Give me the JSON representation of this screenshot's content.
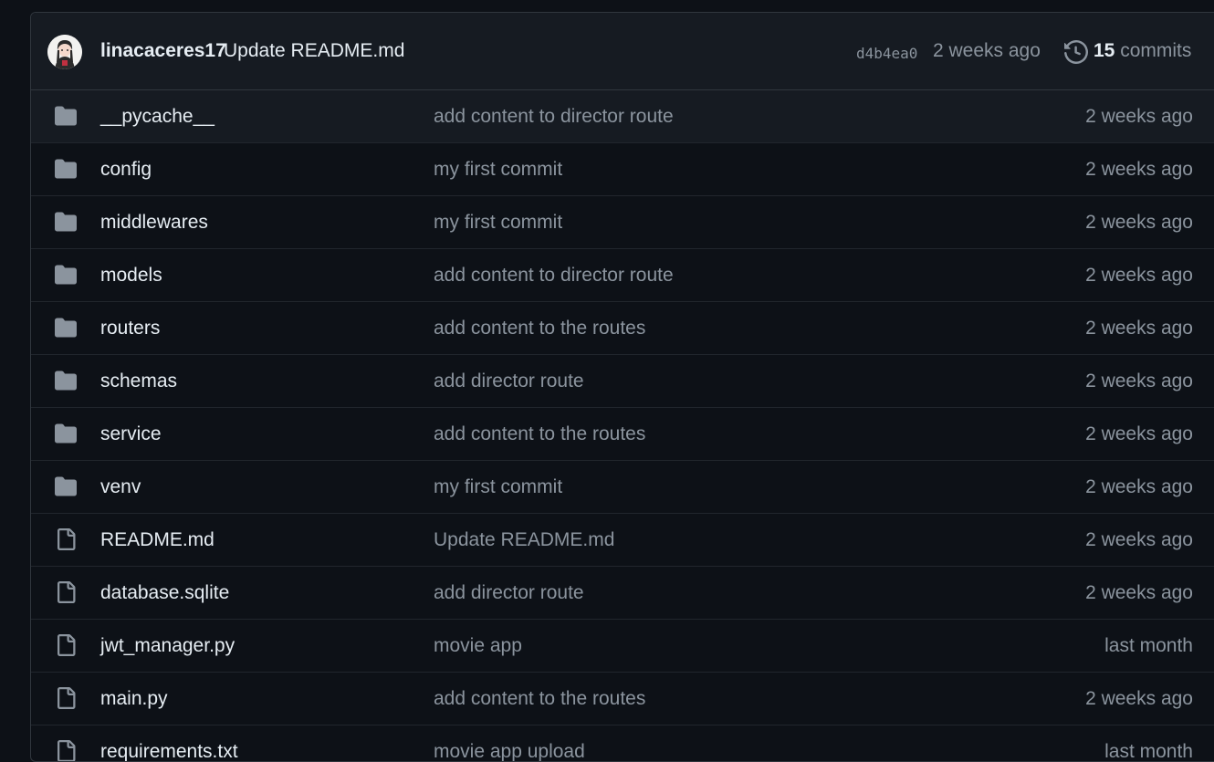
{
  "latest_commit": {
    "author": "linacaceres17",
    "message": "Update README.md",
    "hash": "d4b4ea0",
    "time": "2 weeks ago",
    "commit_count": "15",
    "commit_label": "commits"
  },
  "files": [
    {
      "type": "folder",
      "name": "__pycache__",
      "message": "add content to director route",
      "age": "2 weeks ago"
    },
    {
      "type": "folder",
      "name": "config",
      "message": "my first commit",
      "age": "2 weeks ago"
    },
    {
      "type": "folder",
      "name": "middlewares",
      "message": "my first commit",
      "age": "2 weeks ago"
    },
    {
      "type": "folder",
      "name": "models",
      "message": "add content to director route",
      "age": "2 weeks ago"
    },
    {
      "type": "folder",
      "name": "routers",
      "message": "add content to the routes",
      "age": "2 weeks ago"
    },
    {
      "type": "folder",
      "name": "schemas",
      "message": "add director route",
      "age": "2 weeks ago"
    },
    {
      "type": "folder",
      "name": "service",
      "message": "add content to the routes",
      "age": "2 weeks ago"
    },
    {
      "type": "folder",
      "name": "venv",
      "message": "my first commit",
      "age": "2 weeks ago"
    },
    {
      "type": "file",
      "name": "README.md",
      "message": "Update README.md",
      "age": "2 weeks ago"
    },
    {
      "type": "file",
      "name": "database.sqlite",
      "message": "add director route",
      "age": "2 weeks ago"
    },
    {
      "type": "file",
      "name": "jwt_manager.py",
      "message": "movie app",
      "age": "last month"
    },
    {
      "type": "file",
      "name": "main.py",
      "message": "add content to the routes",
      "age": "2 weeks ago"
    },
    {
      "type": "file",
      "name": "requirements.txt",
      "message": "movie app upload",
      "age": "last month"
    }
  ],
  "colors": {
    "background": "#0d1117",
    "header_bg": "#161b22",
    "border": "#30363d",
    "text": "#e6edf3",
    "muted": "#8b949e",
    "icon": "#8b949e"
  },
  "icons": {
    "folder": "folder-icon",
    "file": "file-icon",
    "history": "history-icon"
  }
}
